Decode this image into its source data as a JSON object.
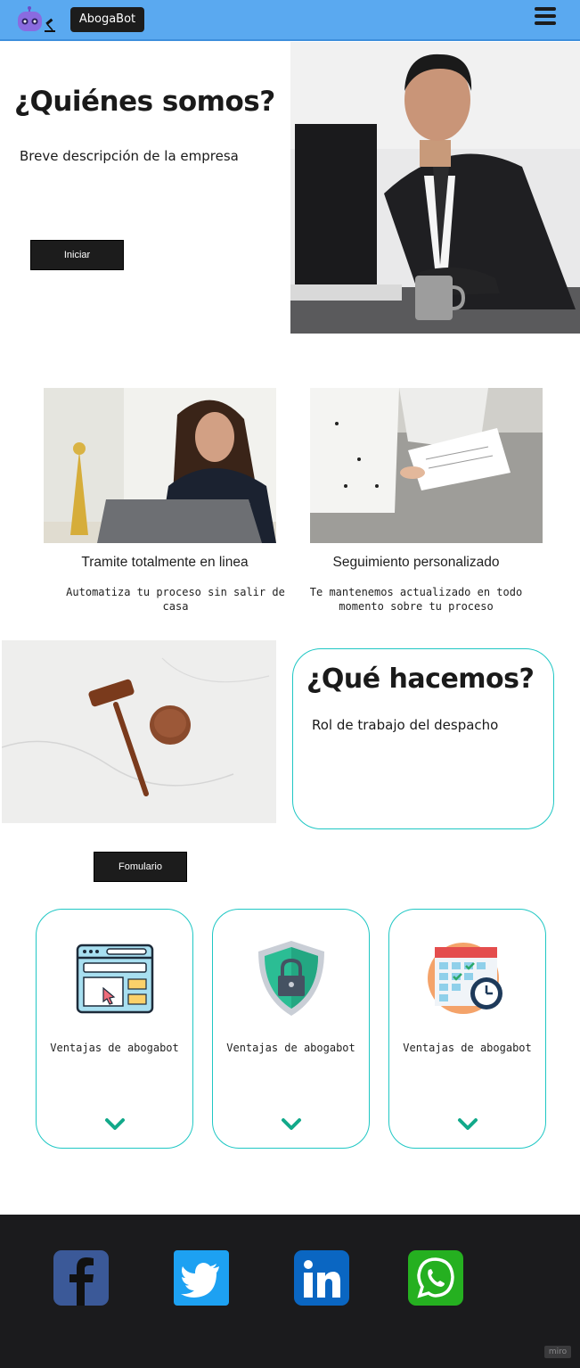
{
  "header": {
    "brand_label": "AbogaBot",
    "logo_icon": "robot-gavel-icon",
    "menu_icon": "hamburger-menu-icon",
    "bg_color": "#5aa9f0"
  },
  "hero": {
    "title": "¿Quiénes somos?",
    "description": "Breve descripción de la empresa",
    "start_label": "Iniciar",
    "photo": "lawyer-at-desk-photo"
  },
  "features": [
    {
      "image": "woman-laptop-photo",
      "title": "Tramite totalmente en linea",
      "description": "Automatiza tu proceso sin salir de casa"
    },
    {
      "image": "documents-signing-photo",
      "title": "Seguimiento personalizado",
      "description": "Te mantenemos actualizado en todo momento sobre tu proceso"
    }
  ],
  "what_we_do": {
    "title": "¿Qué hacemos?",
    "description": "Rol de trabajo del despacho",
    "photo": "gavel-photo",
    "form_label": "Fomulario"
  },
  "benefits": [
    {
      "icon": "browser-window-icon",
      "label": "Ventajas de abogabot"
    },
    {
      "icon": "shield-lock-icon",
      "label": "Ventajas de abogabot"
    },
    {
      "icon": "calendar-clock-icon",
      "label": "Ventajas de abogabot"
    }
  ],
  "accent_color": "#1fc7c4",
  "footer": {
    "bg_color": "#1b1b1d",
    "social": [
      {
        "name": "facebook",
        "icon": "facebook-icon",
        "color": "#3b5998"
      },
      {
        "name": "twitter",
        "icon": "twitter-icon",
        "color": "#1da1f2"
      },
      {
        "name": "linkedin",
        "icon": "linkedin-icon",
        "color": "#0a66c2"
      },
      {
        "name": "whatsapp",
        "icon": "whatsapp-icon",
        "color": "#25b020"
      }
    ],
    "badge": "miro"
  }
}
